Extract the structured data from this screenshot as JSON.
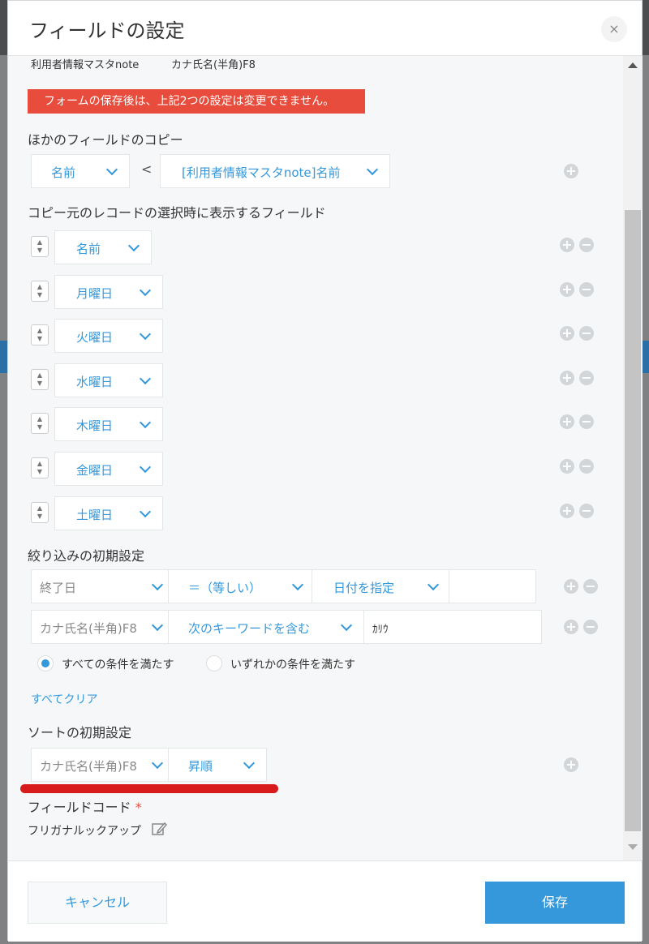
{
  "dialog": {
    "title": "フィールドの設定",
    "close_label": "×"
  },
  "lookup": {
    "source_app": "利用者情報マスタnote",
    "key_field": "カナ氏名(半角)F8",
    "warning": "フォームの保存後は、上記2つの設定は変更できません。"
  },
  "copy_section": {
    "title": "ほかのフィールドのコピー",
    "dest_field": "名前",
    "arrow": "<",
    "source_field": "[利用者情報マスタnote]名前"
  },
  "display_section": {
    "title": "コピー元のレコードの選択時に表示するフィールド",
    "fields": [
      "名前",
      "月曜日",
      "火曜日",
      "水曜日",
      "木曜日",
      "金曜日",
      "土曜日"
    ]
  },
  "filter_section": {
    "title": "絞り込みの初期設定",
    "rows": [
      {
        "field": "終了日",
        "operator": "＝（等しい）",
        "value_type": "日付を指定",
        "value": ""
      },
      {
        "field": "カナ氏名(半角)F8",
        "operator": "次のキーワードを含む",
        "value": "ｶﾘｳ"
      }
    ],
    "radio_all": "すべての条件を満たす",
    "radio_any": "いずれかの条件を満たす",
    "clear_all": "すべてクリア"
  },
  "sort_section": {
    "title": "ソートの初期設定",
    "field": "カナ氏名(半角)F8",
    "order": "昇順"
  },
  "field_code": {
    "title": "フィールドコード",
    "required_mark": "*",
    "value": "フリガナルックアップ"
  },
  "footer": {
    "cancel_label": "キャンセル",
    "save_label": "保存"
  },
  "colors": {
    "accent": "#3498db",
    "warning": "#e74c3c",
    "annotation": "#d81b1b"
  }
}
